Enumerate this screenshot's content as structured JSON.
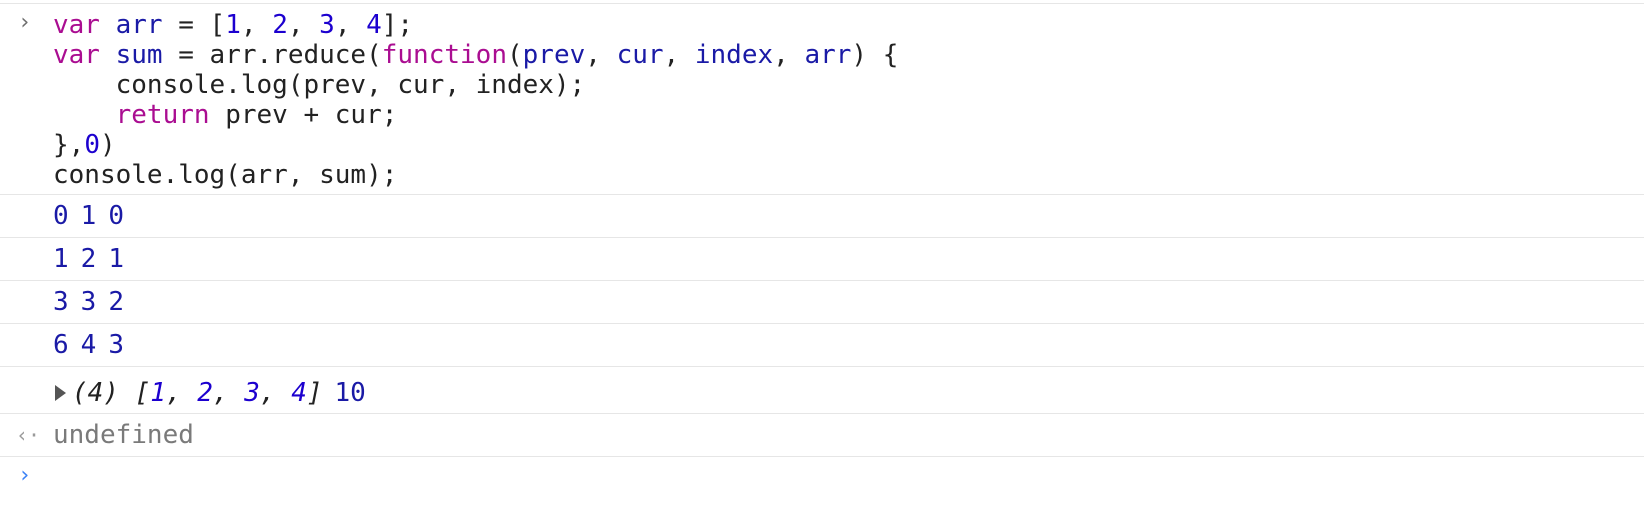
{
  "input_block": {
    "prompt_icon": "chevron-right-icon",
    "lines": [
      [
        {
          "t": "var",
          "c": "kw"
        },
        {
          "t": " ",
          "c": "plain"
        },
        {
          "t": "arr",
          "c": "ident"
        },
        {
          "t": " = [",
          "c": "plain"
        },
        {
          "t": "1",
          "c": "num"
        },
        {
          "t": ", ",
          "c": "plain"
        },
        {
          "t": "2",
          "c": "num"
        },
        {
          "t": ", ",
          "c": "plain"
        },
        {
          "t": "3",
          "c": "num"
        },
        {
          "t": ", ",
          "c": "plain"
        },
        {
          "t": "4",
          "c": "num"
        },
        {
          "t": "];",
          "c": "plain"
        }
      ],
      [
        {
          "t": "var",
          "c": "kw"
        },
        {
          "t": " ",
          "c": "plain"
        },
        {
          "t": "sum",
          "c": "ident"
        },
        {
          "t": " = arr.reduce(",
          "c": "plain"
        },
        {
          "t": "function",
          "c": "fn-kw"
        },
        {
          "t": "(",
          "c": "plain"
        },
        {
          "t": "prev",
          "c": "ident"
        },
        {
          "t": ", ",
          "c": "plain"
        },
        {
          "t": "cur",
          "c": "ident"
        },
        {
          "t": ", ",
          "c": "plain"
        },
        {
          "t": "index",
          "c": "ident"
        },
        {
          "t": ", ",
          "c": "plain"
        },
        {
          "t": "arr",
          "c": "ident"
        },
        {
          "t": ") {",
          "c": "plain"
        }
      ],
      [
        {
          "t": "    console.log(prev, cur, index);",
          "c": "plain"
        }
      ],
      [
        {
          "t": "    ",
          "c": "plain"
        },
        {
          "t": "return",
          "c": "kw"
        },
        {
          "t": " prev + cur;",
          "c": "plain"
        }
      ],
      [
        {
          "t": "},",
          "c": "plain"
        },
        {
          "t": "0",
          "c": "num"
        },
        {
          "t": ")",
          "c": "plain"
        }
      ],
      [
        {
          "t": "console.log(arr, sum);",
          "c": "plain"
        }
      ]
    ]
  },
  "log_rows": [
    [
      "0",
      "1",
      "0"
    ],
    [
      "1",
      "2",
      "1"
    ],
    [
      "3",
      "3",
      "2"
    ],
    [
      "6",
      "4",
      "3"
    ]
  ],
  "array_log": {
    "expand_icon": "expand-triangle-icon",
    "count_label": "(4)",
    "open_bracket": "[",
    "items": [
      "1",
      "2",
      "3",
      "4"
    ],
    "close_bracket": "]",
    "sum_value": "10"
  },
  "result": {
    "icon": "return-arrow-icon",
    "value": "undefined"
  },
  "prompt": {
    "icon": "chevron-right-icon"
  },
  "colors": {
    "keyword": "#aa0d91",
    "number": "#1c00cf",
    "identifier": "#1a1aa6",
    "prompt_active": "#3b82f6"
  }
}
